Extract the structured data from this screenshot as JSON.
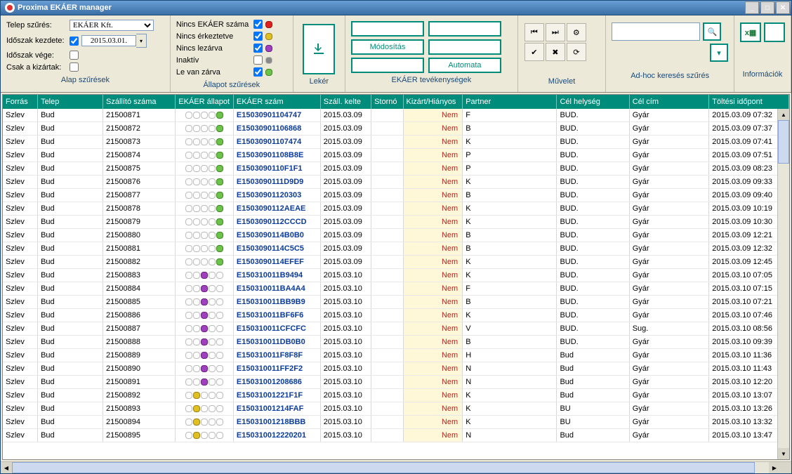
{
  "title": "Proxima EKÁER manager",
  "filters": {
    "telep_label": "Telep szűrés:",
    "telep_value": "EKÁER Kft.",
    "kezdete_label": "Időszak kezdete:",
    "kezdete_value": "2015.03.01.",
    "vege_label": "Időszak vége:",
    "kizartak_label": "Csak a kizártak:",
    "panel_label": "Alap szűrések"
  },
  "status_filters": {
    "nincs_ekaer": "Nincs EKÁER száma",
    "nincs_erkeztetve": "Nincs érkeztetve",
    "nincs_lezarva": "Nincs lezárva",
    "inaktiv": "Inaktív",
    "lezarva": "Le van zárva",
    "panel_label": "Állapot szűrések"
  },
  "panels": {
    "leker": "Lekér",
    "tevekenysegek": "EKÁER tevékenységek",
    "modositas": "Módosítás",
    "automata": "Automata",
    "muvelet": "Művelet",
    "adhoc": "Ad-hoc keresés szűrés",
    "info": "Információk"
  },
  "columns": [
    "Forrás",
    "Telep",
    "Szállító száma",
    "EKÁER állapot",
    "EKÁER szám",
    "Száll. kelte",
    "Stornó",
    "Kizárt/Hiányos",
    "Partner",
    "Cél helység",
    "Cél cím",
    "Töltési időpont"
  ],
  "rows": [
    {
      "f": "Szlev",
      "t": "Bud",
      "sz": "21500871",
      "st": [
        0,
        0,
        0,
        0,
        "green"
      ],
      "ek": "E15030901104747",
      "d": "2015.03.09",
      "kh": "Nem",
      "p": "F",
      "ch": "BUD.",
      "cc": "Gyár",
      "ti": "2015.03.09 07:32"
    },
    {
      "f": "Szlev",
      "t": "Bud",
      "sz": "21500872",
      "st": [
        0,
        0,
        0,
        0,
        "green"
      ],
      "ek": "E15030901106868",
      "d": "2015.03.09",
      "kh": "Nem",
      "p": "B",
      "ch": "BUD.",
      "cc": "Gyár",
      "ti": "2015.03.09 07:37"
    },
    {
      "f": "Szlev",
      "t": "Bud",
      "sz": "21500873",
      "st": [
        0,
        0,
        0,
        0,
        "green"
      ],
      "ek": "E15030901107474",
      "d": "2015.03.09",
      "kh": "Nem",
      "p": "K",
      "ch": "BUD.",
      "cc": "Gyár",
      "ti": "2015.03.09 07:41"
    },
    {
      "f": "Szlev",
      "t": "Bud",
      "sz": "21500874",
      "st": [
        0,
        0,
        0,
        0,
        "green"
      ],
      "ek": "E15030901108B8E",
      "d": "2015.03.09",
      "kh": "Nem",
      "p": "P",
      "ch": "BUD.",
      "cc": "Gyár",
      "ti": "2015.03.09 07:51"
    },
    {
      "f": "Szlev",
      "t": "Bud",
      "sz": "21500875",
      "st": [
        0,
        0,
        0,
        0,
        "green"
      ],
      "ek": "E1503090110F1F1",
      "d": "2015.03.09",
      "kh": "Nem",
      "p": "P",
      "ch": "BUD.",
      "cc": "Gyár",
      "ti": "2015.03.09 08:23"
    },
    {
      "f": "Szlev",
      "t": "Bud",
      "sz": "21500876",
      "st": [
        0,
        0,
        0,
        0,
        "green"
      ],
      "ek": "E1503090111D9D9",
      "d": "2015.03.09",
      "kh": "Nem",
      "p": "K",
      "ch": "BUD.",
      "cc": "Gyár",
      "ti": "2015.03.09 09:33"
    },
    {
      "f": "Szlev",
      "t": "Bud",
      "sz": "21500877",
      "st": [
        0,
        0,
        0,
        0,
        "green"
      ],
      "ek": "E15030901120303",
      "d": "2015.03.09",
      "kh": "Nem",
      "p": "B",
      "ch": "BUD.",
      "cc": "Gyár",
      "ti": "2015.03.09 09:40"
    },
    {
      "f": "Szlev",
      "t": "Bud",
      "sz": "21500878",
      "st": [
        0,
        0,
        0,
        0,
        "green"
      ],
      "ek": "E1503090112AEAE",
      "d": "2015.03.09",
      "kh": "Nem",
      "p": "K",
      "ch": "BUD.",
      "cc": "Gyár",
      "ti": "2015.03.09 10:19"
    },
    {
      "f": "Szlev",
      "t": "Bud",
      "sz": "21500879",
      "st": [
        0,
        0,
        0,
        0,
        "green"
      ],
      "ek": "E1503090112CCCD",
      "d": "2015.03.09",
      "kh": "Nem",
      "p": "K",
      "ch": "BUD.",
      "cc": "Gyár",
      "ti": "2015.03.09 10:30"
    },
    {
      "f": "Szlev",
      "t": "Bud",
      "sz": "21500880",
      "st": [
        0,
        0,
        0,
        0,
        "green"
      ],
      "ek": "E1503090114B0B0",
      "d": "2015.03.09",
      "kh": "Nem",
      "p": "B",
      "ch": "BUD.",
      "cc": "Gyár",
      "ti": "2015.03.09 12:21"
    },
    {
      "f": "Szlev",
      "t": "Bud",
      "sz": "21500881",
      "st": [
        0,
        0,
        0,
        0,
        "green"
      ],
      "ek": "E1503090114C5C5",
      "d": "2015.03.09",
      "kh": "Nem",
      "p": "B",
      "ch": "BUD.",
      "cc": "Gyár",
      "ti": "2015.03.09 12:32"
    },
    {
      "f": "Szlev",
      "t": "Bud",
      "sz": "21500882",
      "st": [
        0,
        0,
        0,
        0,
        "green"
      ],
      "ek": "E1503090114EFEF",
      "d": "2015.03.09",
      "kh": "Nem",
      "p": "K",
      "ch": "BUD.",
      "cc": "Gyár",
      "ti": "2015.03.09 12:45"
    },
    {
      "f": "Szlev",
      "t": "Bud",
      "sz": "21500883",
      "st": [
        0,
        0,
        "purple",
        0,
        0
      ],
      "ek": "E150310011B9494",
      "d": "2015.03.10",
      "kh": "Nem",
      "p": "K",
      "ch": "BUD.",
      "cc": "Gyár",
      "ti": "2015.03.10 07:05"
    },
    {
      "f": "Szlev",
      "t": "Bud",
      "sz": "21500884",
      "st": [
        0,
        0,
        "purple",
        0,
        0
      ],
      "ek": "E150310011BA4A4",
      "d": "2015.03.10",
      "kh": "Nem",
      "p": "F",
      "ch": "BUD.",
      "cc": "Gyár",
      "ti": "2015.03.10 07:15"
    },
    {
      "f": "Szlev",
      "t": "Bud",
      "sz": "21500885",
      "st": [
        0,
        0,
        "purple",
        0,
        0
      ],
      "ek": "E150310011BB9B9",
      "d": "2015.03.10",
      "kh": "Nem",
      "p": "B",
      "ch": "BUD.",
      "cc": "Gyár",
      "ti": "2015.03.10 07:21"
    },
    {
      "f": "Szlev",
      "t": "Bud",
      "sz": "21500886",
      "st": [
        0,
        0,
        "purple",
        0,
        0
      ],
      "ek": "E150310011BF6F6",
      "d": "2015.03.10",
      "kh": "Nem",
      "p": "K",
      "ch": "BUD.",
      "cc": "Gyár",
      "ti": "2015.03.10 07:46"
    },
    {
      "f": "Szlev",
      "t": "Bud",
      "sz": "21500887",
      "st": [
        0,
        0,
        "purple",
        0,
        0
      ],
      "ek": "E150310011CFCFC",
      "d": "2015.03.10",
      "kh": "Nem",
      "p": "V",
      "ch": "BUD.",
      "cc": "Sug.",
      "ti": "2015.03.10 08:56"
    },
    {
      "f": "Szlev",
      "t": "Bud",
      "sz": "21500888",
      "st": [
        0,
        0,
        "purple",
        0,
        0
      ],
      "ek": "E150310011DB0B0",
      "d": "2015.03.10",
      "kh": "Nem",
      "p": "B",
      "ch": "BUD.",
      "cc": "Gyár",
      "ti": "2015.03.10 09:39"
    },
    {
      "f": "Szlev",
      "t": "Bud",
      "sz": "21500889",
      "st": [
        0,
        0,
        "purple",
        0,
        0
      ],
      "ek": "E150310011F8F8F",
      "d": "2015.03.10",
      "kh": "Nem",
      "p": "H",
      "ch": "Bud",
      "cc": "Gyár",
      "ti": "2015.03.10 11:36"
    },
    {
      "f": "Szlev",
      "t": "Bud",
      "sz": "21500890",
      "st": [
        0,
        0,
        "purple",
        0,
        0
      ],
      "ek": "E150310011FF2F2",
      "d": "2015.03.10",
      "kh": "Nem",
      "p": "N",
      "ch": "Bud",
      "cc": "Gyár",
      "ti": "2015.03.10 11:43"
    },
    {
      "f": "Szlev",
      "t": "Bud",
      "sz": "21500891",
      "st": [
        0,
        0,
        "purple",
        0,
        0
      ],
      "ek": "E15031001208686",
      "d": "2015.03.10",
      "kh": "Nem",
      "p": "N",
      "ch": "Bud",
      "cc": "Gyár",
      "ti": "2015.03.10 12:20"
    },
    {
      "f": "Szlev",
      "t": "Bud",
      "sz": "21500892",
      "st": [
        0,
        "yellow",
        0,
        0,
        0
      ],
      "ek": "E15031001221F1F",
      "d": "2015.03.10",
      "kh": "Nem",
      "p": "K",
      "ch": "Bud",
      "cc": "Gyár",
      "ti": "2015.03.10 13:07"
    },
    {
      "f": "Szlev",
      "t": "Bud",
      "sz": "21500893",
      "st": [
        0,
        "yellow",
        0,
        0,
        0
      ],
      "ek": "E15031001214FAF",
      "d": "2015.03.10",
      "kh": "Nem",
      "p": "K",
      "ch": "BU",
      "cc": "Gyár",
      "ti": "2015.03.10 13:26"
    },
    {
      "f": "Szlev",
      "t": "Bud",
      "sz": "21500894",
      "st": [
        0,
        "yellow",
        0,
        0,
        0
      ],
      "ek": "E15031001218BBB",
      "d": "2015.03.10",
      "kh": "Nem",
      "p": "K",
      "ch": "BU",
      "cc": "Gyár",
      "ti": "2015.03.10 13:32"
    },
    {
      "f": "Szlev",
      "t": "Bud",
      "sz": "21500895",
      "st": [
        0,
        "yellow",
        0,
        0,
        0
      ],
      "ek": "E150310012220201",
      "d": "2015.03.10",
      "kh": "Nem",
      "p": "N",
      "ch": "Bud",
      "cc": "Gyár",
      "ti": "2015.03.10 13:47"
    }
  ]
}
